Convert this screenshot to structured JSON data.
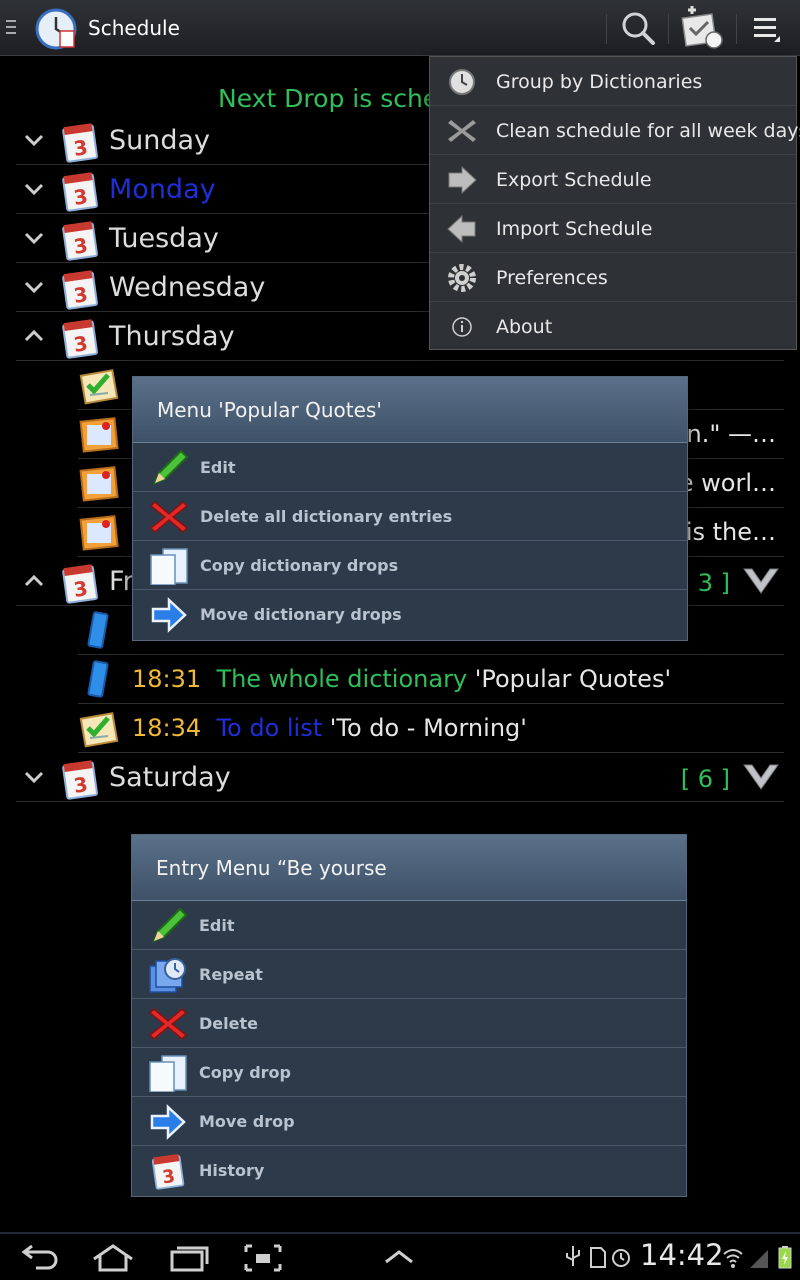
{
  "app": {
    "title": "Schedule"
  },
  "header": {
    "next_drop": "Next Drop is sche"
  },
  "days": {
    "sunday": "Sunday",
    "monday": "Monday",
    "tuesday": "Tuesday",
    "wednesday": "Wednesday",
    "thursday": "Thursday",
    "friday": "Fr",
    "saturday": "Saturday"
  },
  "counts": {
    "friday": "[ 3 ]",
    "saturday": "[ 6 ]"
  },
  "thursday_entries": {
    "trunc1": "en.\" —…",
    "trunc2": "e worl…",
    "trunc3": "is the…"
  },
  "friday_entries": [
    {
      "time": "18:31",
      "kind": "The whole dictionary",
      "name": " 'Popular Quotes'"
    },
    {
      "time": "18:34",
      "kind": "To do list",
      "name": " 'To do - Morning'"
    }
  ],
  "overflow_menu": {
    "items": [
      {
        "label": "Group by Dictionaries",
        "icon": "clock-icon"
      },
      {
        "label": "Clean schedule for all week days",
        "icon": "cross-icon"
      },
      {
        "label": "Export Schedule",
        "icon": "export-arrow-icon"
      },
      {
        "label": "Import Schedule",
        "icon": "import-arrow-icon"
      },
      {
        "label": "Preferences",
        "icon": "gear-icon"
      },
      {
        "label": "About",
        "icon": "info-icon"
      }
    ]
  },
  "dictionary_menu": {
    "title": "Menu 'Popular Quotes'",
    "items": [
      {
        "label": "Edit",
        "icon": "pencil-icon"
      },
      {
        "label": "Delete all dictionary entries",
        "icon": "red-x-icon"
      },
      {
        "label": "Copy dictionary drops",
        "icon": "copy-icon"
      },
      {
        "label": "Move dictionary drops",
        "icon": "move-arrow-icon"
      }
    ]
  },
  "entry_menu": {
    "title": "Entry Menu “Be yourse",
    "items": [
      {
        "label": "Edit",
        "icon": "pencil-icon"
      },
      {
        "label": "Repeat",
        "icon": "repeat-icon"
      },
      {
        "label": "Delete",
        "icon": "red-x-icon"
      },
      {
        "label": "Copy drop",
        "icon": "copy-icon"
      },
      {
        "label": "Move drop",
        "icon": "move-arrow-icon"
      },
      {
        "label": "History",
        "icon": "calendar-icon"
      }
    ]
  },
  "status": {
    "time": "14:42"
  },
  "colors": {
    "green": "#2fbf5a",
    "time": "#f0b93a",
    "blue": "#1f2fd8",
    "dialog": "#2c3a4a"
  }
}
